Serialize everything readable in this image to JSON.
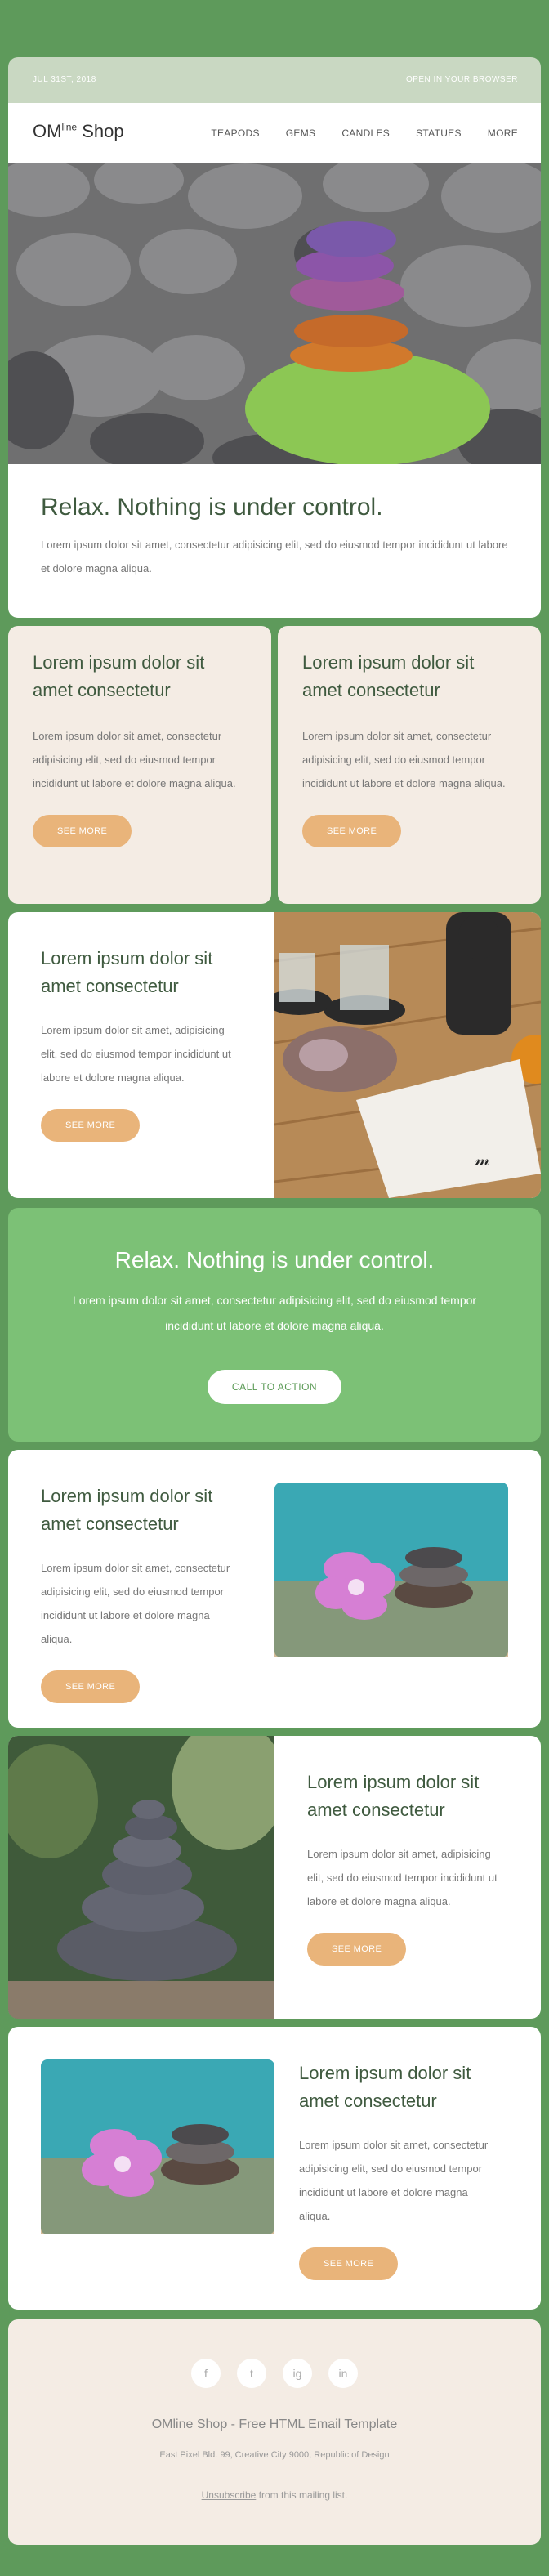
{
  "topbar": {
    "date": "JUL 31ST, 2018",
    "open_browser": "OPEN IN YOUR BROWSER"
  },
  "brand": {
    "name_prefix": "OM",
    "name_sup": "line",
    "name_suffix": " Shop"
  },
  "menu": [
    "TEAPODS",
    "GEMS",
    "CANDLES",
    "STATUES",
    "MORE"
  ],
  "intro": {
    "title": "Relax. Nothing is under control.",
    "body": "Lorem ipsum dolor sit amet, consectetur adipisicing elit, sed do eiusmod tempor incididunt ut labore et dolore magna aliqua."
  },
  "two_col": [
    {
      "title": "Lorem ipsum dolor sit amet consectetur",
      "body": "Lorem ipsum dolor sit amet, consectetur adipisicing elit, sed do eiusmod tempor incididunt ut labore et dolore magna aliqua.",
      "button": "SEE MORE"
    },
    {
      "title": "Lorem ipsum dolor sit amet consectetur",
      "body": "Lorem ipsum dolor sit amet, consectetur adipisicing elit, sed do eiusmod tempor incididunt ut labore et dolore magna aliqua.",
      "button": "SEE MORE"
    }
  ],
  "row1": {
    "title": "Lorem ipsum dolor sit amet consectetur",
    "body": "Lorem ipsum dolor sit amet, adipisicing elit, sed do eiusmod tempor incididunt ut labore et dolore magna aliqua.",
    "button": "SEE MORE"
  },
  "cta": {
    "title": "Relax. Nothing is under control.",
    "body": "Lorem ipsum dolor sit amet, consectetur adipisicing elit, sed do eiusmod tempor incididunt ut labore et dolore magna aliqua.",
    "button": "CALL TO ACTION"
  },
  "row2": {
    "title": "Lorem ipsum dolor sit amet consectetur",
    "body": "Lorem ipsum dolor sit amet, consectetur adipisicing elit, sed do eiusmod tempor incididunt ut labore et dolore magna aliqua.",
    "button": "SEE MORE"
  },
  "row3": {
    "title": "Lorem ipsum dolor sit amet consectetur",
    "body": "Lorem ipsum dolor sit amet, adipisicing elit, sed do eiusmod tempor incididunt ut labore et dolore magna aliqua.",
    "button": "SEE MORE"
  },
  "row4": {
    "title": "Lorem ipsum dolor sit amet consectetur",
    "body": "Lorem ipsum dolor sit amet, consectetur adipisicing elit, sed do eiusmod tempor incididunt ut labore et dolore magna aliqua.",
    "button": "SEE MORE"
  },
  "footer": {
    "social": [
      "f",
      "t",
      "ig",
      "in"
    ],
    "title": "OMline Shop - Free HTML Email Template",
    "address": "East Pixel Bld. 99, Creative City 9000, Republic of Design",
    "unsubscribe": "Unsubscribe",
    "unsubscribe_rest": " from this mailing list."
  },
  "colors": {
    "page_bg": "#5e9a5b",
    "cta_bg": "#7cc176",
    "button": "#e9b47a",
    "soft_bg": "#f4ece4",
    "topbar": "#c9d8c2"
  }
}
